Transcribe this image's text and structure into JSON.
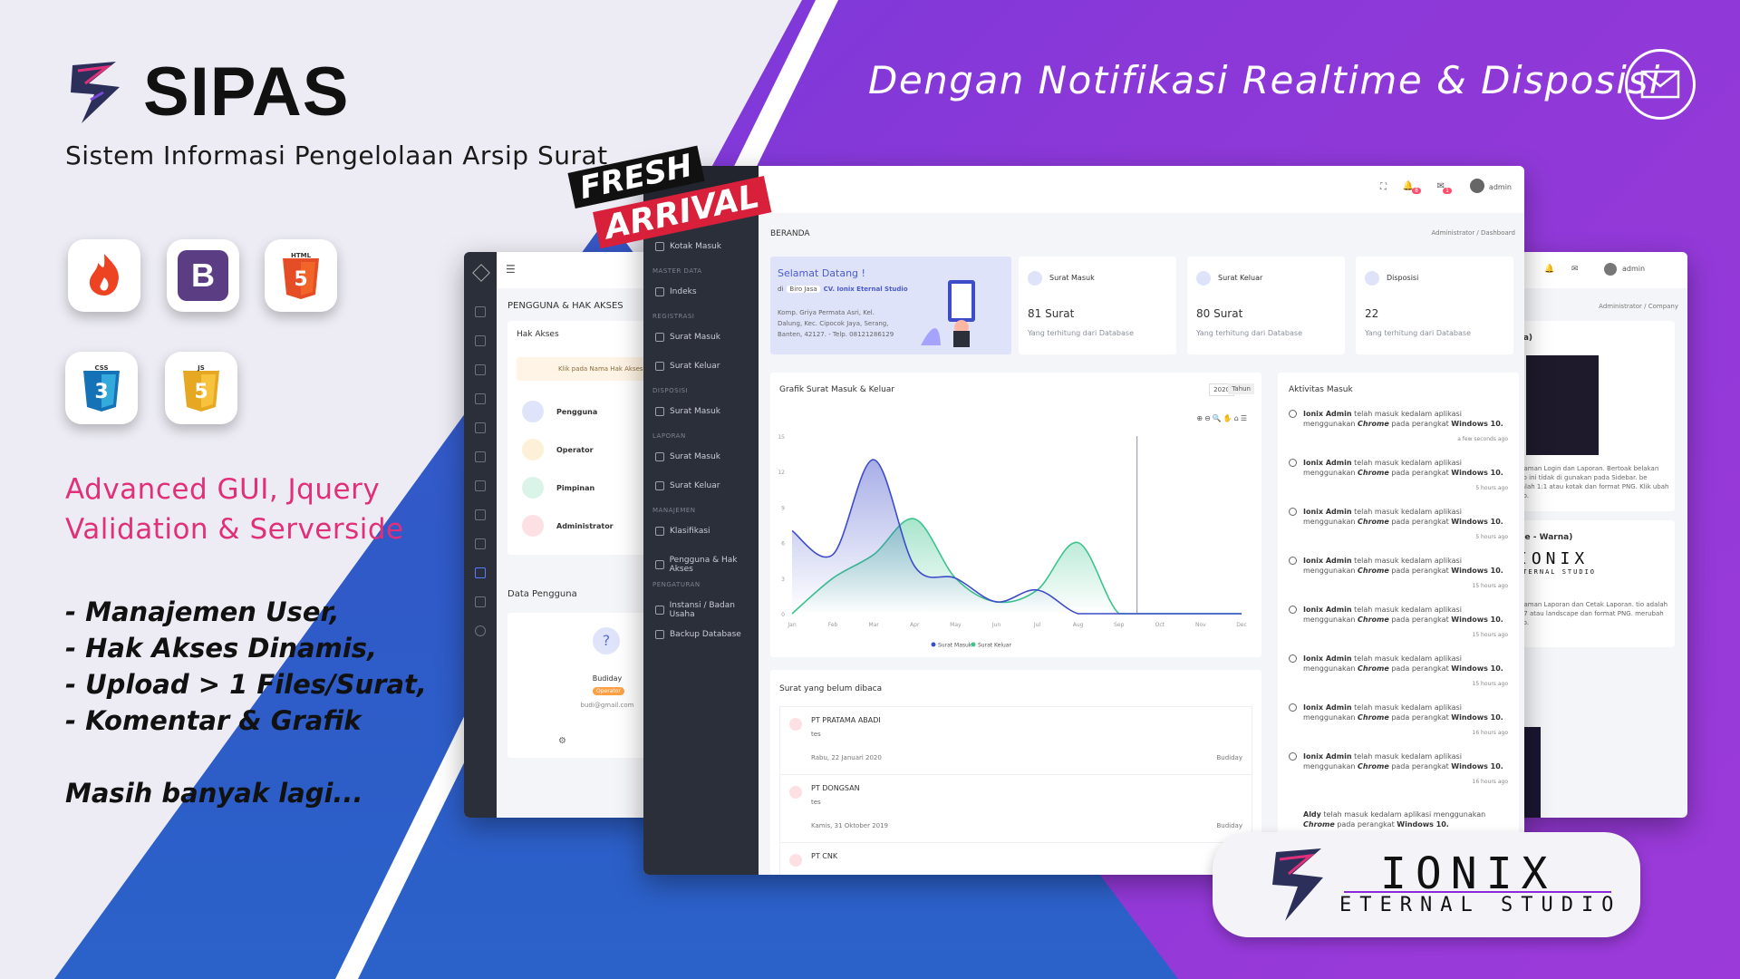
{
  "brand": {
    "name": "SIPAS",
    "subtitle": "Sistem Informasi Pengelolaan Arsip Surat"
  },
  "tagline": "Dengan Notifikasi Realtime & Disposisi",
  "tech_icons": [
    {
      "name": "codeigniter-icon",
      "label": "CodeIgniter"
    },
    {
      "name": "bootstrap-icon",
      "label": "B"
    },
    {
      "name": "html5-icon",
      "label": "HTML"
    },
    {
      "name": "css3-icon",
      "label": "CSS"
    },
    {
      "name": "javascript-icon",
      "label": "JS"
    }
  ],
  "feature": {
    "line1": "Advanced GUI, Jquery",
    "line2": "Validation & Serverside"
  },
  "bullets": [
    "- Manajemen User,",
    "- Hak Akses Dinamis,",
    "- Upload > 1 Files/Surat,",
    "- Komentar & Grafik"
  ],
  "more": "Masih banyak lagi...",
  "badge": {
    "line1": "FRESH",
    "line2": "ARRIVAL"
  },
  "studio": {
    "name": "IONIX",
    "sub": "ETERNAL STUDIO"
  },
  "colors": {
    "purple": "#8b38d8",
    "blue": "#2f5ac8",
    "pink": "#e0307a",
    "sidebar": "#2b2f3a"
  },
  "left_screen": {
    "section_title": "PENGGUNA & HAK AKSES",
    "card_title": "Hak Akses",
    "hint": "Klik pada Nama Hak Akses",
    "roles": [
      "Pengguna",
      "Operator",
      "Pimpinan",
      "Administrator"
    ],
    "data_title": "Data Pengguna",
    "user": {
      "name": "Budiday",
      "role": "Operator",
      "email": "budi@gmail.com"
    }
  },
  "main_screen": {
    "topbar": {
      "user": "admin",
      "notif_count": "8",
      "mail_count": "1"
    },
    "breadcrumb_title": "BERANDA",
    "breadcrumb_path": "Administrator / Dashboard",
    "sidebar": {
      "items": [
        {
          "section": "",
          "label": "Beranda"
        },
        {
          "section": "",
          "label": "Kotak Masuk"
        },
        {
          "section": "MASTER DATA",
          "label": "Indeks"
        },
        {
          "section": "REGISTRASI",
          "label": "Surat Masuk"
        },
        {
          "section": "",
          "label": "Surat Keluar"
        },
        {
          "section": "DISPOSISI",
          "label": "Surat Masuk"
        },
        {
          "section": "LAPORAN",
          "label": "Surat Masuk"
        },
        {
          "section": "",
          "label": "Surat Keluar"
        },
        {
          "section": "MANAJEMEN",
          "label": "Klasifikasi"
        },
        {
          "section": "",
          "label": "Pengguna & Hak Akses"
        },
        {
          "section": "PENGATURAN",
          "label": "Instansi / Badan Usaha"
        },
        {
          "section": "",
          "label": "Backup Database"
        }
      ]
    },
    "welcome": {
      "title": "Selamat Datang !",
      "di": "di",
      "tag": "Biro Jasa",
      "company": "CV. Ionix Eternal Studio",
      "address": "Komp. Griya Permata Asri, Kel. Dalung, Kec. Cipocok Jaya, Serang, Banten, 42127. - Telp. 08121286129"
    },
    "stats": [
      {
        "title": "Surat Masuk",
        "value": "81 Surat",
        "note": "Yang terhitung dari Database"
      },
      {
        "title": "Surat Keluar",
        "value": "80 Surat",
        "note": "Yang terhitung dari Database"
      },
      {
        "title": "Disposisi",
        "value": "22",
        "note": "Yang terhitung dari Database"
      }
    ],
    "chart_card": {
      "title": "Grafik Surat Masuk & Keluar",
      "year": "2020",
      "period": "Tahun"
    },
    "unread": {
      "title": "Surat yang belum dibaca",
      "items": [
        {
          "company": "PT PRATAMA ABADI",
          "subject": "tes",
          "date": "Rabu, 22 Januari 2020",
          "user": "Budiday"
        },
        {
          "company": "PT DONGSAN",
          "subject": "tes",
          "date": "Kamis, 31 Oktober 2019",
          "user": "Budiday"
        },
        {
          "company": "PT CNK",
          "subject": "",
          "date": "",
          "user": ""
        }
      ]
    },
    "activity": {
      "title": "Aktivitas Masuk",
      "items": [
        {
          "user": "Ionix Admin",
          "text": "telah masuk kedalam aplikasi menggunakan",
          "browser": "Chrome",
          "pre": "pada perangkat",
          "os": "Windows 10.",
          "time": "a few seconds ago"
        },
        {
          "user": "Ionix Admin",
          "text": "telah masuk kedalam aplikasi menggunakan",
          "browser": "Chrome",
          "pre": "pada perangkat",
          "os": "Windows 10.",
          "time": "5 hours ago"
        },
        {
          "user": "Ionix Admin",
          "text": "telah masuk kedalam aplikasi menggunakan",
          "browser": "Chrome",
          "pre": "pada perangkat",
          "os": "Windows 10.",
          "time": "5 hours ago"
        },
        {
          "user": "Ionix Admin",
          "text": "telah masuk kedalam aplikasi menggunakan",
          "browser": "Chrome",
          "pre": "pada perangkat",
          "os": "Windows 10.",
          "time": "15 hours ago"
        },
        {
          "user": "Ionix Admin",
          "text": "telah masuk kedalam aplikasi menggunakan",
          "browser": "Chrome",
          "pre": "pada perangkat",
          "os": "Windows 10.",
          "time": "15 hours ago"
        },
        {
          "user": "Ionix Admin",
          "text": "telah masuk kedalam aplikasi menggunakan",
          "browser": "Chrome",
          "pre": "pada perangkat",
          "os": "Windows 10.",
          "time": "15 hours ago"
        },
        {
          "user": "Ionix Admin",
          "text": "telah masuk kedalam aplikasi menggunakan",
          "browser": "Chrome",
          "pre": "pada perangkat",
          "os": "Windows 10.",
          "time": "16 hours ago"
        },
        {
          "user": "Ionix Admin",
          "text": "telah masuk kedalam aplikasi menggunakan",
          "browser": "Chrome",
          "pre": "pada perangkat",
          "os": "Windows 10.",
          "time": "16 hours ago"
        }
      ],
      "last": {
        "user": "Aldy",
        "text": "telah masuk kedalam aplikasi menggunakan",
        "browser": "Chrome",
        "pre": "pada perangkat",
        "os": "Windows 10."
      }
    }
  },
  "right_screen": {
    "breadcrumb": "Administrator / Company",
    "user": "admin",
    "section1": "rna)",
    "text1": "Halaman Login dan Laporan. Bertoak belakan logo ini tidak di gunakan pada Sidebar. be adalah 1:1 atau kotak dan format PNG. Klik ubah logo.",
    "section2": "ape - Warna)",
    "brand_snip": "IONIX",
    "brand_snip_sub": "ETERNAL STUDIO",
    "text2": "Halaman Laporan dan Cetak Laporan. tio adalah 23:7 atau landscape dan format PNG. merubah logo."
  },
  "chart_data": {
    "type": "area",
    "categories": [
      "Jan",
      "Feb",
      "Mar",
      "Apr",
      "May",
      "Jun",
      "Jul",
      "Aug",
      "Sep",
      "Oct",
      "Nov",
      "Dec"
    ],
    "series": [
      {
        "name": "Surat Masuk",
        "values": [
          7,
          5,
          13,
          4,
          3,
          1,
          2,
          0,
          0,
          0,
          0,
          0
        ],
        "color": "#3d4cc9"
      },
      {
        "name": "Surat Keluar",
        "values": [
          0,
          3,
          5,
          8,
          3,
          1,
          2,
          6,
          0,
          0,
          0,
          0
        ],
        "color": "#3cc48d"
      }
    ],
    "yticks": [
      0,
      3,
      6,
      9,
      12,
      15
    ],
    "ylim": [
      0,
      15
    ],
    "legend": "bottom",
    "grid": false
  }
}
